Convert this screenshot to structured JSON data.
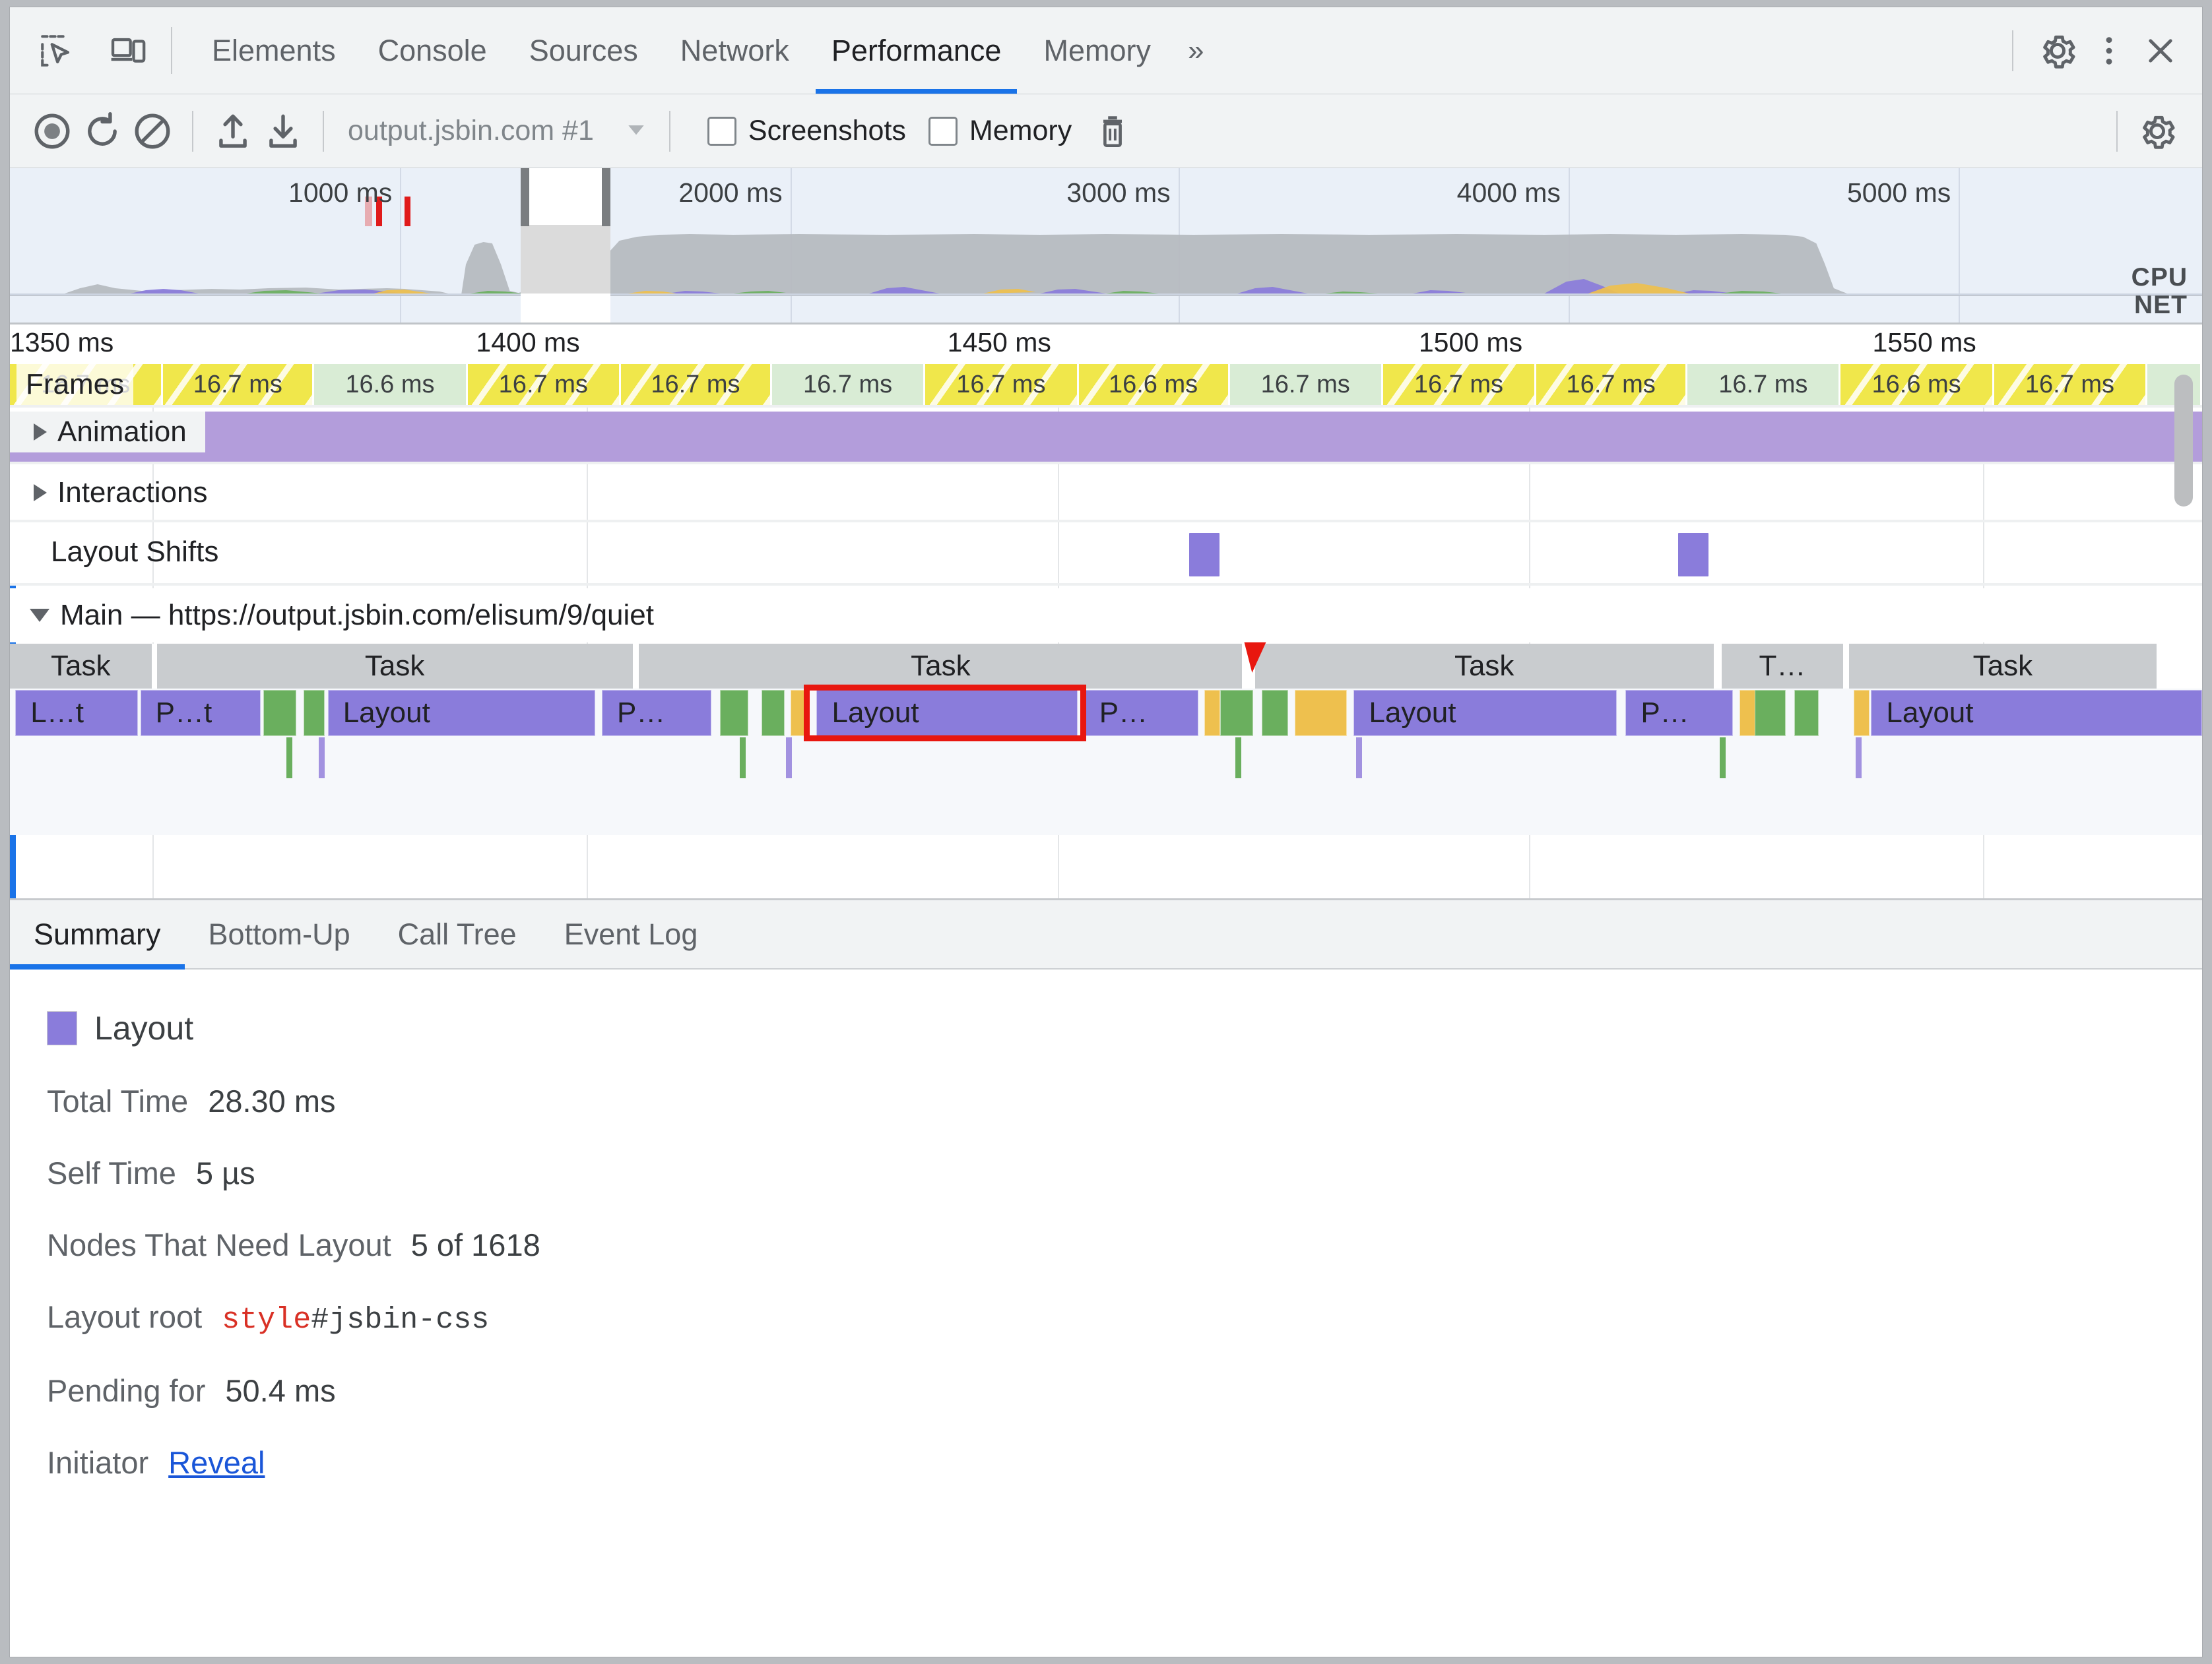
{
  "window": {
    "bg": "#b9bcc0"
  },
  "devtools_tabs": {
    "icons": [
      {
        "name": "inspect-element-icon",
        "title": "Inspect element"
      },
      {
        "name": "device-toolbar-icon",
        "title": "Toggle device toolbar"
      }
    ],
    "items": [
      {
        "label": "Elements",
        "active": false
      },
      {
        "label": "Console",
        "active": false
      },
      {
        "label": "Sources",
        "active": false
      },
      {
        "label": "Network",
        "active": false
      },
      {
        "label": "Performance",
        "active": true
      },
      {
        "label": "Memory",
        "active": false
      }
    ],
    "more_label": "»",
    "right_icons": [
      {
        "name": "settings-gear-icon"
      },
      {
        "name": "more-options-icon"
      },
      {
        "name": "close-devtools-icon"
      }
    ],
    "accent": "#1a73e8"
  },
  "record_toolbar": {
    "record_title": "Record",
    "reload_title": "Record and reload",
    "clear_title": "Clear",
    "upload_title": "Load profile",
    "download_title": "Save profile",
    "session_name": "output.jsbin.com #1",
    "dropdown_glyph": "▼",
    "checkboxes": [
      {
        "label": "Screenshots",
        "checked": false
      },
      {
        "label": "Memory",
        "checked": false
      }
    ],
    "trash_title": "Collect garbage",
    "capture_settings_title": "Capture settings"
  },
  "overview": {
    "ticks": [
      {
        "label": "1000 ms",
        "x_pct": 17.8
      },
      {
        "label": "2000 ms",
        "x_pct": 35.6
      },
      {
        "label": "3000 ms",
        "x_pct": 53.3
      },
      {
        "label": "4000 ms",
        "x_pct": 71.1
      },
      {
        "label": "5000 ms",
        "x_pct": 88.9
      }
    ],
    "cpu_label": "CPU",
    "net_label": "NET",
    "selection_start_pct": 23.3,
    "selection_end_pct": 27.4,
    "colors": {
      "background": "#eaf0f8",
      "cpu_fill": "#b6bac0",
      "scripting": "#eec04e",
      "rendering": "#8a7cdb",
      "painting": "#6aaf5e",
      "longtask_marker": "#e01b1b"
    }
  },
  "ruler": {
    "ticks": [
      {
        "label": "1350 ms",
        "x_pct": 0.0
      },
      {
        "label": "1400 ms",
        "x_pct": 26.3
      },
      {
        "label": "1450 ms",
        "x_pct": 47.8
      },
      {
        "label": "1500 ms",
        "x_pct": 69.3
      },
      {
        "label": "1550 ms",
        "x_pct": 90.0
      }
    ]
  },
  "frames_track": {
    "title": "Frames",
    "frames": [
      {
        "duration": "16.7 ms",
        "type": "partial"
      },
      {
        "duration": "16.7 ms",
        "type": "partial"
      },
      {
        "duration": "16.6 ms",
        "type": "good"
      },
      {
        "duration": "16.7 ms",
        "type": "partial"
      },
      {
        "duration": "16.7 ms",
        "type": "partial"
      },
      {
        "duration": "16.7 ms",
        "type": "good"
      },
      {
        "duration": "16.7 ms",
        "type": "partial"
      },
      {
        "duration": "16.6 ms",
        "type": "partial"
      },
      {
        "duration": "16.7 ms",
        "type": "good"
      },
      {
        "duration": "16.7 ms",
        "type": "partial"
      },
      {
        "duration": "16.7 ms",
        "type": "partial"
      },
      {
        "duration": "16.7 ms",
        "type": "good"
      },
      {
        "duration": "16.6 ms",
        "type": "partial"
      },
      {
        "duration": "16.7 ms",
        "type": "partial"
      },
      {
        "duration": "",
        "type": "good"
      }
    ]
  },
  "tracks": {
    "animation": {
      "label": "Animation",
      "expanded": false,
      "color": "#b39ddb"
    },
    "interactions": {
      "label": "Interactions",
      "expanded": false
    },
    "layout_shifts": {
      "label": "Layout Shifts",
      "markers": [
        {
          "x_pct": 53.8
        },
        {
          "x_pct": 76.1
        }
      ],
      "color": "#8a7cdb"
    },
    "main": {
      "label": "Main — https://output.jsbin.com/elisum/9/quiet",
      "expanded": true,
      "tasks": [
        {
          "label": "Task",
          "x_pct": 0.0,
          "w_pct": 6.55
        },
        {
          "label": "Task",
          "x_pct": 6.7,
          "w_pct": 21.8
        },
        {
          "label": "Task",
          "x_pct": 28.7,
          "w_pct": 27.6
        },
        {
          "label": "Task",
          "x_pct": 56.8,
          "w_pct": 21.0
        },
        {
          "label": "T…",
          "x_pct": 78.1,
          "w_pct": 5.6
        },
        {
          "label": "Task",
          "x_pct": 83.9,
          "w_pct": 14.1
        }
      ],
      "warning_marker_x_pct": 56.6,
      "events": [
        {
          "label": "L…t",
          "type": "purple",
          "x_pct": 0.25,
          "w_pct": 5.6
        },
        {
          "label": "P…t",
          "type": "purple",
          "x_pct": 5.95,
          "w_pct": 5.5
        },
        {
          "label": "",
          "type": "green",
          "x_pct": 11.55,
          "w_pct": 1.5
        },
        {
          "label": "",
          "type": "green",
          "x_pct": 13.4,
          "w_pct": 0.95
        },
        {
          "label": "Layout",
          "type": "purple",
          "x_pct": 14.5,
          "w_pct": 12.2
        },
        {
          "label": "P…",
          "type": "purple",
          "x_pct": 27.0,
          "w_pct": 5.0
        },
        {
          "label": "",
          "type": "green",
          "x_pct": 32.4,
          "w_pct": 1.3
        },
        {
          "label": "",
          "type": "green",
          "x_pct": 34.3,
          "w_pct": 1.05
        },
        {
          "label": "",
          "type": "yellow",
          "x_pct": 35.6,
          "w_pct": 0.85
        },
        {
          "label": "Layout",
          "type": "purple",
          "x_pct": 36.8,
          "w_pct": 11.9,
          "selected": true
        },
        {
          "label": "P…",
          "type": "purple",
          "x_pct": 49.0,
          "w_pct": 5.2
        },
        {
          "label": "",
          "type": "yellow",
          "x_pct": 54.5,
          "w_pct": 0.55
        },
        {
          "label": "",
          "type": "green",
          "x_pct": 55.2,
          "w_pct": 1.5
        },
        {
          "label": "",
          "type": "green",
          "x_pct": 57.1,
          "w_pct": 1.2
        },
        {
          "label": "",
          "type": "yellow",
          "x_pct": 58.6,
          "w_pct": 2.4
        },
        {
          "label": "Layout",
          "type": "purple",
          "x_pct": 61.3,
          "w_pct": 12.0
        },
        {
          "label": "P…",
          "type": "purple",
          "x_pct": 73.7,
          "w_pct": 4.9
        },
        {
          "label": "",
          "type": "yellow",
          "x_pct": 78.9,
          "w_pct": 0.5
        },
        {
          "label": "",
          "type": "green",
          "x_pct": 79.6,
          "w_pct": 1.4
        },
        {
          "label": "",
          "type": "green",
          "x_pct": 81.4,
          "w_pct": 1.1
        },
        {
          "label": "",
          "type": "yellow",
          "x_pct": 84.1,
          "w_pct": 0.5
        },
        {
          "label": "Layout",
          "type": "purple",
          "x_pct": 84.9,
          "w_pct": 15.1
        }
      ],
      "sub_ticks": [
        {
          "type": "green",
          "x_pct": 12.6
        },
        {
          "type": "purple",
          "x_pct": 14.1
        },
        {
          "type": "green",
          "x_pct": 33.3
        },
        {
          "type": "purple",
          "x_pct": 35.4
        },
        {
          "type": "green",
          "x_pct": 55.9
        },
        {
          "type": "purple",
          "x_pct": 61.4
        },
        {
          "type": "green",
          "x_pct": 78.0
        },
        {
          "type": "purple",
          "x_pct": 84.2
        }
      ]
    }
  },
  "detail_tabs": {
    "items": [
      {
        "label": "Summary",
        "active": true
      },
      {
        "label": "Bottom-Up",
        "active": false
      },
      {
        "label": "Call Tree",
        "active": false
      },
      {
        "label": "Event Log",
        "active": false
      }
    ]
  },
  "summary": {
    "event_name": "Layout",
    "swatch_color": "#8a7cdb",
    "rows": [
      {
        "label": "Total Time",
        "value": "28.30 ms",
        "kind": "text"
      },
      {
        "label": "Self Time",
        "value": "5 µs",
        "kind": "text"
      },
      {
        "label": "Nodes That Need Layout",
        "value": "5 of 1618",
        "kind": "text"
      },
      {
        "label": "Layout root",
        "value_tag": "style",
        "value_rest": "#jsbin-css",
        "kind": "mono"
      },
      {
        "label": "Pending for",
        "value": "50.4 ms",
        "kind": "text"
      },
      {
        "label": "Initiator",
        "value": "Reveal",
        "kind": "link"
      }
    ]
  }
}
